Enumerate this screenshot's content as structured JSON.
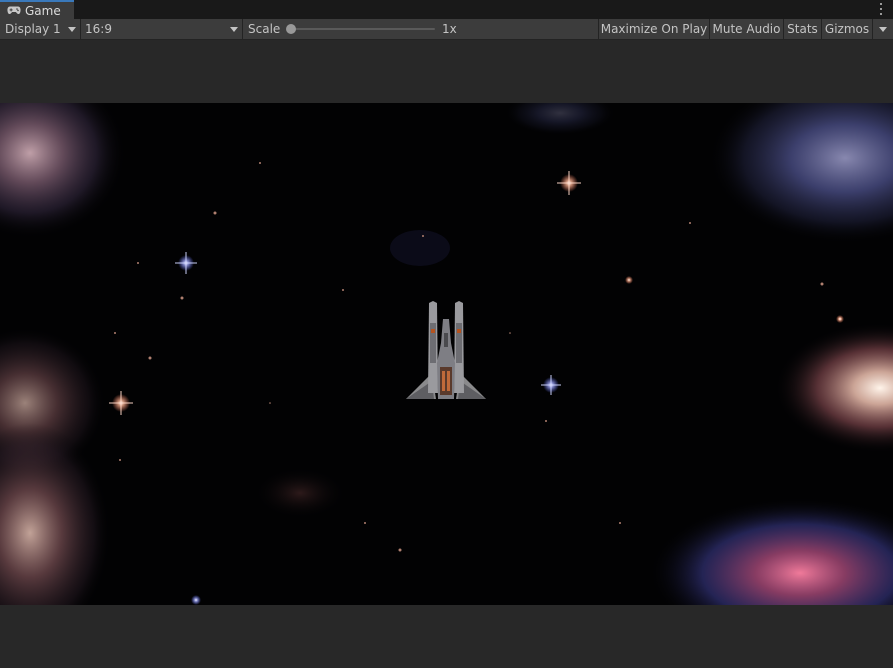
{
  "tab": {
    "label": "Game",
    "icon": "gamepad-icon"
  },
  "toolbar": {
    "display_label": "Display 1",
    "aspect_label": "16:9",
    "scale_label": "Scale",
    "scale_value": "1x",
    "scale_slider_value": 0,
    "maximize_label": "Maximize On Play",
    "mute_label": "Mute Audio",
    "stats_label": "Stats",
    "gizmos_label": "Gizmos"
  },
  "colors": {
    "editor_bg": "#282828",
    "toolbar_bg": "#3c3c3c",
    "tab_accent": "#3a79bb",
    "space_bg": "#020203"
  },
  "scene": {
    "description_icon": "spaceship-sprite",
    "background": "space-nebula"
  }
}
